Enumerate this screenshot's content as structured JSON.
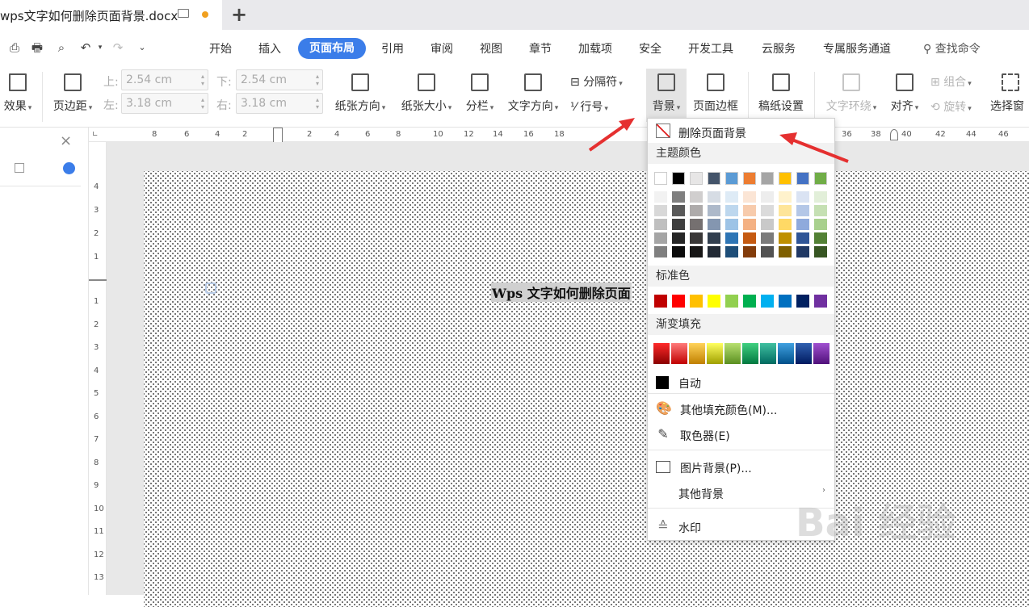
{
  "tab": {
    "title": "wps文字如何删除页面背景.docx",
    "new_tab": "+"
  },
  "menu": {
    "items": [
      "开始",
      "插入",
      "页面布局",
      "引用",
      "审阅",
      "视图",
      "章节",
      "加载项",
      "安全",
      "开发工具",
      "云服务",
      "专属服务通道"
    ],
    "active": "页面布局",
    "search": "查找命令"
  },
  "ribbon": {
    "effects": "效果",
    "margins": "页边距",
    "top_label": "上:",
    "top_value": "2.54 cm",
    "left_label": "左:",
    "left_value": "3.18 cm",
    "bottom_label": "下:",
    "bottom_value": "2.54 cm",
    "right_label": "右:",
    "right_value": "3.18 cm",
    "orientation": "纸张方向",
    "size": "纸张大小",
    "columns": "分栏",
    "text_direction": "文字方向",
    "separator": "分隔符",
    "line_number": "行号",
    "background": "背景",
    "page_border": "页面边框",
    "paper_setup": "稿纸设置",
    "text_wrap": "文字环绕",
    "align": "对齐",
    "group": "组合",
    "rotate": "旋转",
    "select_pane": "选择窗"
  },
  "ruler": {
    "h": [
      "8",
      "6",
      "4",
      "2",
      "2",
      "4",
      "6",
      "8",
      "10",
      "12",
      "14",
      "16",
      "18",
      "36",
      "38",
      "40",
      "42",
      "44",
      "46"
    ],
    "v_top": [
      "4",
      "3",
      "2",
      "1"
    ],
    "v_bottom": [
      "1",
      "2",
      "3",
      "4",
      "5",
      "6",
      "7",
      "8",
      "9",
      "10",
      "11",
      "12",
      "13"
    ]
  },
  "document": {
    "heading": "Wps 文字如何删除页面"
  },
  "dropdown": {
    "remove_bg": "删除页面背景",
    "theme_colors": "主题颜色",
    "standard_colors": "标准色",
    "gradient_fill": "渐变填充",
    "auto": "自动",
    "more_fill": "其他填充颜色(M)...",
    "eyedropper": "取色器(E)",
    "picture_bg": "图片背景(P)...",
    "other_bg": "其他背景",
    "watermark": "水印",
    "theme_row": [
      "#ffffff",
      "#000000",
      "#e7e6e6",
      "#44546a",
      "#5b9bd5",
      "#ed7d31",
      "#a5a5a5",
      "#ffc000",
      "#4472c4",
      "#70ad47"
    ],
    "theme_shades": [
      [
        "#f2f2f2",
        "#d8d8d8",
        "#bfbfbf",
        "#a5a5a5",
        "#7f7f7f"
      ],
      [
        "#7f7f7f",
        "#595959",
        "#3f3f3f",
        "#262626",
        "#0c0c0c"
      ],
      [
        "#d0cece",
        "#aeabab",
        "#757070",
        "#3a3838",
        "#171616"
      ],
      [
        "#d6dce4",
        "#adb9ca",
        "#8496b0",
        "#323f4f",
        "#222a35"
      ],
      [
        "#deebf6",
        "#bdd7ee",
        "#9dc3e6",
        "#2e75b5",
        "#1e4e79"
      ],
      [
        "#fbe5d5",
        "#f7cbac",
        "#f4b183",
        "#c55a11",
        "#833c0b"
      ],
      [
        "#ededed",
        "#dbdbdb",
        "#c9c9c9",
        "#7b7b7b",
        "#525252"
      ],
      [
        "#fff2cc",
        "#fee599",
        "#ffd965",
        "#bf9000",
        "#7f6000"
      ],
      [
        "#dae3f3",
        "#b4c7e7",
        "#8faadc",
        "#2f5597",
        "#203864"
      ],
      [
        "#e2efd9",
        "#c5e0b3",
        "#a8d08d",
        "#538135",
        "#375623"
      ]
    ],
    "standard": [
      "#c00000",
      "#ff0000",
      "#ffc000",
      "#ffff00",
      "#92d050",
      "#00b050",
      "#00b0f0",
      "#0070c0",
      "#002060",
      "#7030a0"
    ],
    "gradients": [
      [
        "#ff2a2a",
        "#8a0000"
      ],
      [
        "#ff7a7a",
        "#c00000"
      ],
      [
        "#ffd35a",
        "#c08000"
      ],
      [
        "#ffff60",
        "#a0a000"
      ],
      [
        "#b8e070",
        "#5a8f20"
      ],
      [
        "#40d080",
        "#007840"
      ],
      [
        "#40c0a0",
        "#006a60"
      ],
      [
        "#40a0e0",
        "#00508a"
      ],
      [
        "#3060b0",
        "#001a60"
      ],
      [
        "#a050d0",
        "#50107a"
      ]
    ]
  },
  "watermark_text": "Bai 经验"
}
